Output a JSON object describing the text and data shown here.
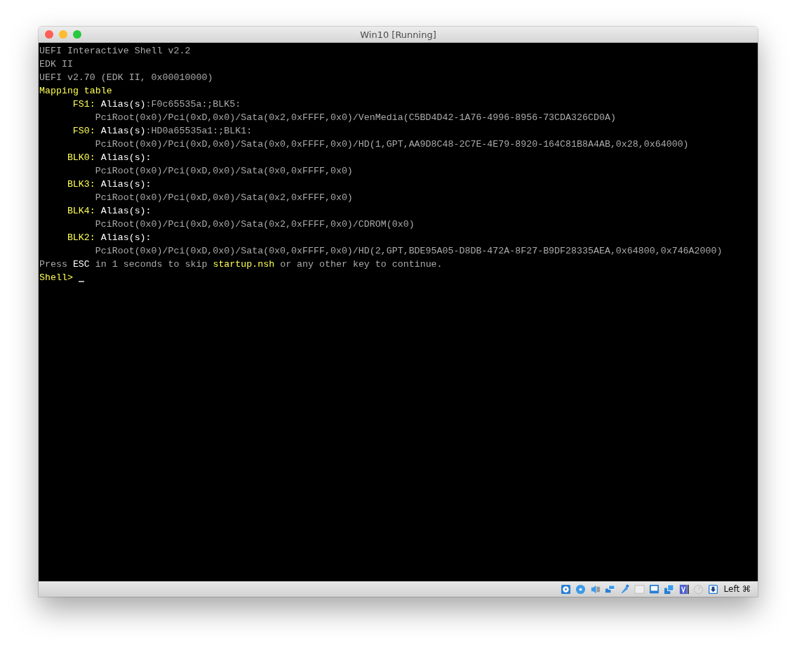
{
  "window": {
    "title": "Win10 [Running]"
  },
  "console": {
    "lines": [
      {
        "kind": "text",
        "segments": [
          {
            "kind": "normal",
            "text": "UEFI Interactive Shell v2.2"
          }
        ]
      },
      {
        "kind": "text",
        "segments": [
          {
            "kind": "normal",
            "text": "EDK II"
          }
        ]
      },
      {
        "kind": "text",
        "segments": [
          {
            "kind": "normal",
            "text": "UEFI v2.70 (EDK II, 0x00010000)"
          }
        ]
      },
      {
        "kind": "text",
        "segments": [
          {
            "kind": "yellow",
            "text": "Mapping table"
          }
        ]
      },
      {
        "kind": "mapping",
        "segments": [
          {
            "kind": "yellow",
            "text": "FS1:"
          },
          {
            "kind": "bright",
            "text": "Alias(s)"
          },
          {
            "kind": "normal",
            "text": ":F0c65535a:;BLK5:"
          }
        ]
      },
      {
        "kind": "path",
        "segments": [
          {
            "kind": "normal",
            "text": "PciRoot(0x0)/Pci(0xD,0x0)/Sata(0x2,0xFFFF,0x0)/VenMedia(C5BD4D42-1A76-4996-8956-73CDA326CD0A)"
          }
        ]
      },
      {
        "kind": "mapping",
        "segments": [
          {
            "kind": "yellow",
            "text": "FS0:"
          },
          {
            "kind": "bright",
            "text": "Alias(s)"
          },
          {
            "kind": "normal",
            "text": ":HD0a65535a1:;BLK1:"
          }
        ]
      },
      {
        "kind": "path",
        "segments": [
          {
            "kind": "normal",
            "text": "PciRoot(0x0)/Pci(0xD,0x0)/Sata(0x0,0xFFFF,0x0)/HD(1,GPT,AA9D8C48-2C7E-4E79-8920-164C81B8A4AB,0x28,0x64000)"
          }
        ]
      },
      {
        "kind": "mapping",
        "segments": [
          {
            "kind": "yellow",
            "text": "BLK0:"
          },
          {
            "kind": "bright",
            "text": "Alias(s):"
          }
        ]
      },
      {
        "kind": "path",
        "segments": [
          {
            "kind": "normal",
            "text": "PciRoot(0x0)/Pci(0xD,0x0)/Sata(0x0,0xFFFF,0x0)"
          }
        ]
      },
      {
        "kind": "mapping",
        "segments": [
          {
            "kind": "yellow",
            "text": "BLK3:"
          },
          {
            "kind": "bright",
            "text": "Alias(s):"
          }
        ]
      },
      {
        "kind": "path",
        "segments": [
          {
            "kind": "normal",
            "text": "PciRoot(0x0)/Pci(0xD,0x0)/Sata(0x2,0xFFFF,0x0)"
          }
        ]
      },
      {
        "kind": "mapping",
        "segments": [
          {
            "kind": "yellow",
            "text": "BLK4:"
          },
          {
            "kind": "bright",
            "text": "Alias(s):"
          }
        ]
      },
      {
        "kind": "path",
        "segments": [
          {
            "kind": "normal",
            "text": "PciRoot(0x0)/Pci(0xD,0x0)/Sata(0x2,0xFFFF,0x0)/CDROM(0x0)"
          }
        ]
      },
      {
        "kind": "mapping",
        "segments": [
          {
            "kind": "yellow",
            "text": "BLK2:"
          },
          {
            "kind": "bright",
            "text": "Alias(s):"
          }
        ]
      },
      {
        "kind": "path",
        "segments": [
          {
            "kind": "normal",
            "text": "PciRoot(0x0)/Pci(0xD,0x0)/Sata(0x0,0xFFFF,0x0)/HD(2,GPT,BDE95A05-D8DB-472A-8F27-B9DF28335AEA,0x64800,0x746A2000)"
          }
        ]
      },
      {
        "kind": "text",
        "segments": [
          {
            "kind": "normal",
            "text": "Press "
          },
          {
            "kind": "bright",
            "text": "ESC"
          },
          {
            "kind": "normal",
            "text": " in 1 seconds to skip "
          },
          {
            "kind": "yellow",
            "text": "startup.nsh"
          },
          {
            "kind": "normal",
            "text": " or any other key to continue."
          }
        ]
      },
      {
        "kind": "prompt",
        "segments": [
          {
            "kind": "yellow",
            "text": "Shell>"
          }
        ]
      }
    ]
  },
  "status_bar": {
    "host_key": "Left ⌘"
  }
}
